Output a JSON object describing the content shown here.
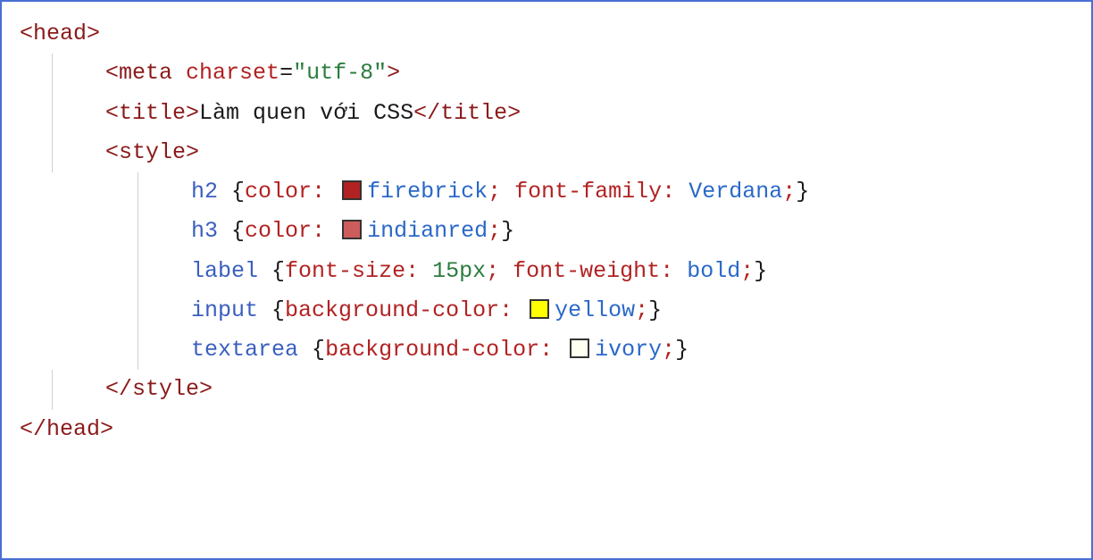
{
  "angle_open": "<",
  "angle_close": ">",
  "angle_end_open": "</",
  "tags": {
    "head": "head",
    "meta": "meta",
    "title": "title",
    "style": "style"
  },
  "meta": {
    "attr": "charset",
    "eq": "=",
    "value": "\"utf-8\""
  },
  "title_text": "Làm quen với CSS",
  "rules": {
    "h2": {
      "selector": "h2",
      "prop1": "color",
      "val1": "firebrick",
      "prop2": "font-family",
      "val2": "Verdana"
    },
    "h3": {
      "selector": "h3",
      "prop1": "color",
      "val1": "indianred"
    },
    "label": {
      "selector": "label",
      "prop1": "font-size",
      "val1_num": "15px",
      "prop2": "font-weight",
      "val2": "bold"
    },
    "input": {
      "selector": "input",
      "prop1": "background-color",
      "val1": "yellow"
    },
    "textarea": {
      "selector": "textarea",
      "prop1": "background-color",
      "val1": "ivory"
    }
  },
  "punct": {
    "brace_open": "{",
    "brace_close": "}",
    "colon": ":",
    "semi": ";",
    "space": " "
  }
}
